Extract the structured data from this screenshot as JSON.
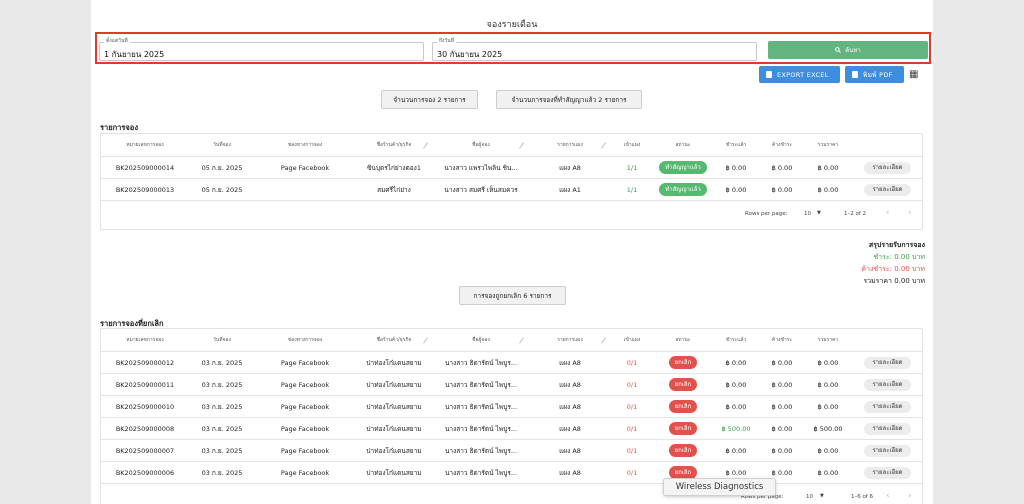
{
  "page_title": "จองรายเดือน",
  "search": {
    "start_label": "ตั้งแต่วันที่",
    "start_value": "1 กันยายน 2025",
    "end_label": "ถึงวันที่",
    "end_value": "30 กันยายน 2025",
    "search_label": "ค้นหา"
  },
  "actions": {
    "export_excel": "EXPORT EXCEL",
    "print_pdf": "พิมพ์ PDF"
  },
  "counts": {
    "bookings": "จำนวนการจอง 2 รายการ",
    "contracted": "จำนวนการจองที่ทำสัญญาแล้ว 2 รายการ",
    "cancelled": "การจองถูกยกเลิก 6 รายการ"
  },
  "bookings": {
    "section_title": "รายการจอง",
    "headers": [
      "หมายเลขการจอง",
      "วันที่จอง",
      "ช่องทางการจอง",
      "ชื่อร้านค้า/ธุรกิจ",
      "ชื่อผู้จอง",
      "รายการแผง",
      "เข้าแผง",
      "สถานะ",
      "ชำระแล้ว",
      "ค้างชำระ",
      "รวมราคา"
    ],
    "rows": [
      {
        "id": "BK202509000014",
        "date": "05 ก.ย. 2025",
        "channel": "Page Facebook",
        "shop": "ซินบุตรไก่ย่างตอง1",
        "name": "นางสาว แพรวไพลิน ชิน...",
        "stall": "แผง A8",
        "enter": "1/1",
        "status": "ทำสัญญาแล้ว",
        "paid": "฿ 0.00",
        "due": "฿ 0.00",
        "total": "฿ 0.00",
        "detail": "รายละเอียด"
      },
      {
        "id": "BK202509000013",
        "date": "05 ก.ย. 2025",
        "channel": "",
        "shop": "สมศรีไก่ย่าง",
        "name": "นางสาว สมศรี เห็นสมควร",
        "stall": "แผง A1",
        "enter": "1/1",
        "status": "ทำสัญญาแล้ว",
        "paid": "฿ 0.00",
        "due": "฿ 0.00",
        "total": "฿ 0.00",
        "detail": "รายละเอียด"
      }
    ],
    "footer": {
      "rows_per_page_label": "Rows per page:",
      "rows_per_page": "10",
      "range": "1–2 of 2"
    }
  },
  "summary": {
    "title": "สรุปรายรับการจอง",
    "paid": "ชำระ: 0.00 บาท",
    "due": "ค้างชำระ: 0.00 บาท",
    "total": "รวมราคา 0.00 บาท"
  },
  "cancelled": {
    "section_title": "รายการจองที่ยกเลิก",
    "headers": [
      "หมายเลขการจอง",
      "วันที่จอง",
      "ช่องทางการจอง",
      "ชื่อร้านค้า/ธุรกิจ",
      "ชื่อผู้จอง",
      "รายการแผง",
      "เข้าแผง",
      "สถานะ",
      "ชำระแล้ว",
      "ค้างชำระ",
      "รวมราคา"
    ],
    "rows": [
      {
        "id": "BK202509000012",
        "date": "03 ก.ย. 2025",
        "channel": "Page Facebook",
        "shop": "ปาท่องโก๋แดนสยาม",
        "name": "นางสาว ธิดารัตน์ ไพบูร...",
        "stall": "แผง A8",
        "enter": "0/1",
        "status": "ยกเลิก",
        "paid": "฿ 0.00",
        "due": "฿ 0.00",
        "total": "฿ 0.00",
        "detail": "รายละเอียด"
      },
      {
        "id": "BK202509000011",
        "date": "03 ก.ย. 2025",
        "channel": "Page Facebook",
        "shop": "ปาท่องโก๋แดนสยาม",
        "name": "นางสาว ธิดารัตน์ ไพบูร...",
        "stall": "แผง A8",
        "enter": "0/1",
        "status": "ยกเลิก",
        "paid": "฿ 0.00",
        "due": "฿ 0.00",
        "total": "฿ 0.00",
        "detail": "รายละเอียด"
      },
      {
        "id": "BK202509000010",
        "date": "03 ก.ย. 2025",
        "channel": "Page Facebook",
        "shop": "ปาท่องโก๋แดนสยาม",
        "name": "นางสาว ธิดารัตน์ ไพบูร...",
        "stall": "แผง A8",
        "enter": "0/1",
        "status": "ยกเลิก",
        "paid": "฿ 0.00",
        "due": "฿ 0.00",
        "total": "฿ 0.00",
        "detail": "รายละเอียด"
      },
      {
        "id": "BK202509000008",
        "date": "03 ก.ย. 2025",
        "channel": "Page Facebook",
        "shop": "ปาท่องโก๋แดนสยาม",
        "name": "นางสาว ธิดารัตน์ ไพบูร...",
        "stall": "แผง A8",
        "enter": "0/1",
        "status": "ยกเลิก",
        "paid": "฿ 500.00",
        "due": "฿ 0.00",
        "total": "฿ 500.00",
        "detail": "รายละเอียด"
      },
      {
        "id": "BK202509000007",
        "date": "03 ก.ย. 2025",
        "channel": "Page Facebook",
        "shop": "ปาท่องโก๋แดนสยาม",
        "name": "นางสาว ธิดารัตน์ ไพบูร...",
        "stall": "แผง A8",
        "enter": "0/1",
        "status": "ยกเลิก",
        "paid": "฿ 0.00",
        "due": "฿ 0.00",
        "total": "฿ 0.00",
        "detail": "รายละเอียด"
      },
      {
        "id": "BK202509000006",
        "date": "03 ก.ย. 2025",
        "channel": "Page Facebook",
        "shop": "ปาท่องโก๋แดนสยาม",
        "name": "นางสาว ธิดารัตน์ ไพบูร...",
        "stall": "แผง A8",
        "enter": "0/1",
        "status": "ยกเลิก",
        "paid": "฿ 0.00",
        "due": "฿ 0.00",
        "total": "฿ 0.00",
        "detail": "รายละเอียด"
      }
    ],
    "footer": {
      "rows_per_page_label": "Rows per page:",
      "rows_per_page": "10",
      "range": "1–6 of 6"
    }
  },
  "tooltip": "Wireless Diagnostics",
  "colors": {
    "green": "#55b96f",
    "red": "#e0524b",
    "blue": "#3d8ede",
    "highlight": "#e03b27",
    "paid_green": "#3a9a4a"
  }
}
